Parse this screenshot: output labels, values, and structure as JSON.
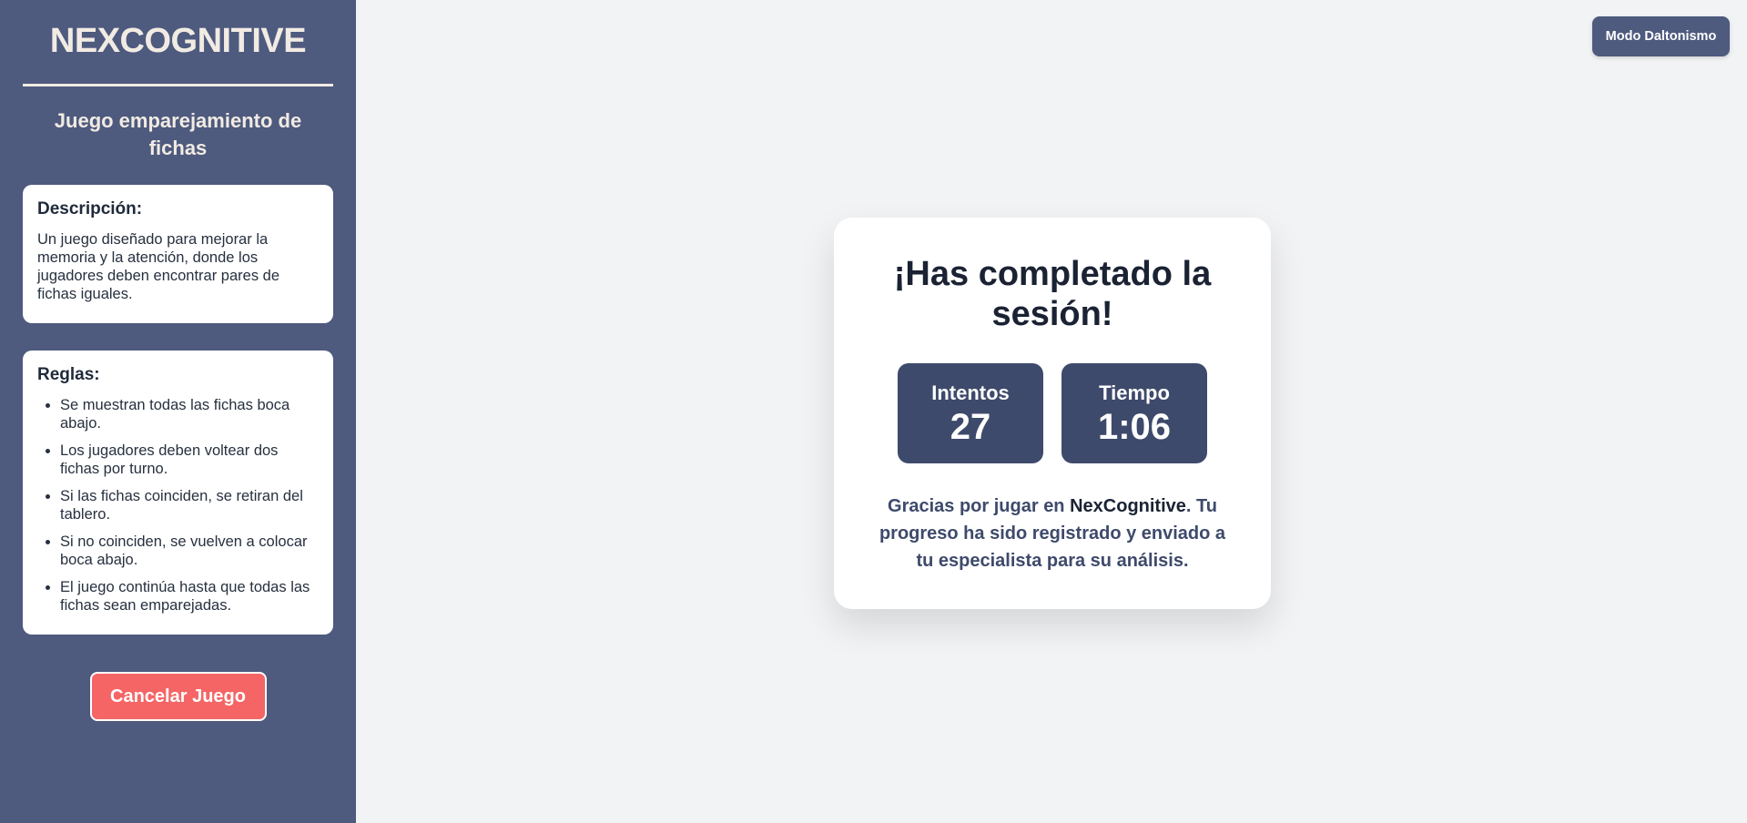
{
  "sidebar": {
    "brand": "NEXCOGNITIVE",
    "game_title": "Juego emparejamiento de fichas",
    "description": {
      "heading": "Descripción:",
      "text": "Un juego diseñado para mejorar la memoria y la atención, donde los jugadores deben encontrar pares de fichas iguales."
    },
    "rules": {
      "heading": "Reglas:",
      "items": [
        "Se muestran todas las fichas boca abajo.",
        "Los jugadores deben voltear dos fichas por turno.",
        "Si las fichas coinciden, se retiran del tablero.",
        "Si no coinciden, se vuelven a colocar boca abajo.",
        "El juego continúa hasta que todas las fichas sean emparejadas."
      ]
    },
    "cancel_label": "Cancelar Juego"
  },
  "header": {
    "mode_label": "Modo Daltonismo"
  },
  "result": {
    "title": "¡Has completado la sesión!",
    "stats": [
      {
        "label": "Intentos",
        "value": "27"
      },
      {
        "label": "Tiempo",
        "value": "1:06"
      }
    ],
    "message_prefix": "Gracias por jugar en ",
    "message_brand": "NexCognitive",
    "message_suffix": ". Tu progreso ha sido registrado y enviado a tu especialista para su análisis."
  },
  "colors": {
    "sidebar_bg": "#4e5a7e",
    "main_bg": "#f2f3f5",
    "stat_bg": "#3e4a6b",
    "cancel_bg": "#f56565",
    "brand_text": "#f1ebe3"
  }
}
